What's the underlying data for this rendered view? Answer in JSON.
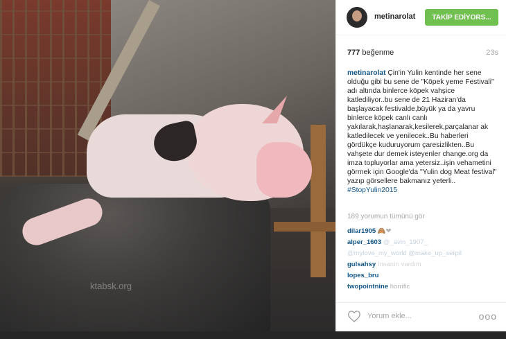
{
  "post": {
    "watermark": "ktabsk.org"
  },
  "header": {
    "username": "metinarolat",
    "follow_label": "TAKİP EDİYORS..."
  },
  "stats": {
    "likes_count": "777",
    "likes_word": "beğenme",
    "time_ago": "23s"
  },
  "caption": {
    "username": "metinarolat",
    "text": "Çin'in Yulin kentinde her sene olduğu gibi bu sene de \"Köpek yeme Festivali\" adı altında binlerce köpek vahşice katlediliyor..bu sene de 21 Haziran'da başlayacak festivalde,büyük ya da yavru binlerce köpek canlı canlı yakılarak,haşlanarak,kesilerek,parçalanar ak katledilecek ve yenilecek..Bu haberleri gördükçe kuduruyorum çaresizlikten..Bu vahşete dur demek isteyenler change.org da imza topluyorlar ama yetersiz..işin vehametini görmek için Google'da \"Yulin dog Meat festival\" yazıp görsellere bakmanız yeterli..",
    "hashtag": "#StopYulin2015"
  },
  "comments": {
    "view_all": "189 yorumun tümünü gör",
    "items": [
      {
        "user": "dilar1905",
        "text": "🙈❤"
      },
      {
        "user": "alper_1603",
        "text": "@_avin_1907_"
      },
      {
        "user": "",
        "text": "@mylove_my_world @make_up_serpil"
      },
      {
        "user": "gulsahsy",
        "text": "İnsanın vardım"
      },
      {
        "user": "lopes_bru",
        "text": ""
      },
      {
        "user": "twopointnine",
        "text": "horrific"
      }
    ]
  },
  "actions": {
    "add_comment_placeholder": "Yorum ekle...",
    "more_options": "ooo"
  },
  "colors": {
    "follow_button": "#70c050",
    "link_blue": "#125688",
    "muted_gray": "#a5a7aa"
  },
  "icons": {
    "like": "heart-outline-icon",
    "more": "three-dots-icon"
  }
}
